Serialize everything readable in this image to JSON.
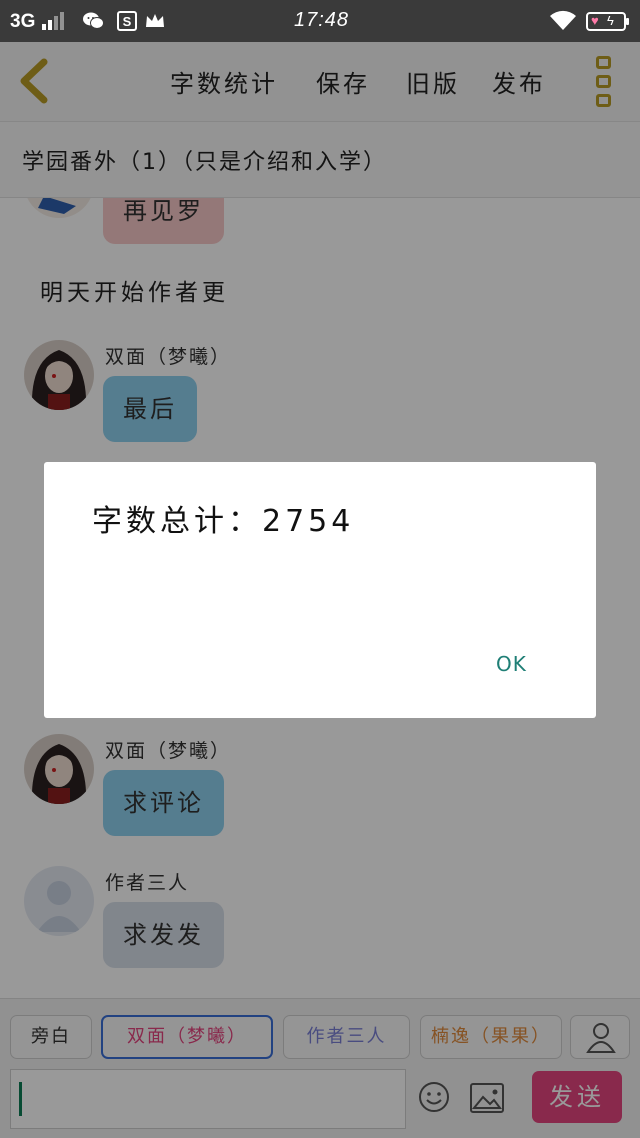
{
  "status_bar": {
    "network": "3G",
    "time": "17:48"
  },
  "toolbar": {
    "word_count": "字数统计",
    "save": "保存",
    "old_version": "旧版",
    "publish": "发布"
  },
  "story_title": "学园番外（1）（只是介绍和入学）",
  "chat": {
    "msg0_text": "再见罗",
    "narration": "明天开始作者更",
    "msg1_sender": "双面（梦曦）",
    "msg1_text": "最后",
    "msg2_sender": "双面（梦曦）",
    "msg2_text": "求评论",
    "msg3_sender": "作者三人",
    "msg3_text": "求发发"
  },
  "roles": {
    "narrator": "旁白",
    "role1": "双面（梦曦）",
    "role2": "作者三人",
    "role3": "楠逸（果果）"
  },
  "composer": {
    "send": "发送"
  },
  "dialog": {
    "label": "字数总计：",
    "count": "2754",
    "ok": "OK"
  },
  "colors": {
    "accent_gold": "#b89b26",
    "send_pink": "#e5457f",
    "selected_role_border": "#3a6fd8",
    "ok_teal": "#1f7f76"
  }
}
